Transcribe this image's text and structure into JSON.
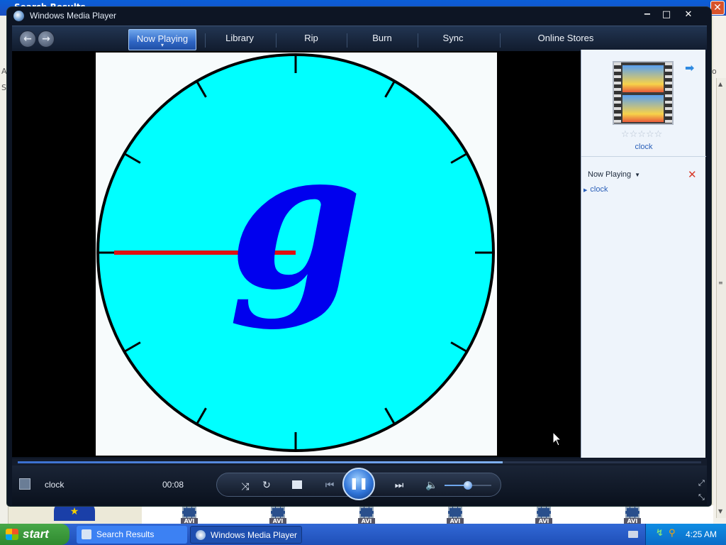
{
  "background": {
    "window_title": "Search Results",
    "left_gutter_letters": [
      "A",
      "S"
    ],
    "right_gutter_letter": "o",
    "file_thumb_label": "AVI"
  },
  "wmp": {
    "title": "Windows Media Player",
    "controls": {
      "minimize": "−",
      "maximize": "□",
      "close": "✕"
    },
    "nav": {
      "back_icon": "back-arrow-icon",
      "forward_icon": "forward-arrow-icon",
      "tabs": [
        {
          "label": "Now Playing",
          "active": true
        },
        {
          "label": "Library",
          "active": false
        },
        {
          "label": "Rip",
          "active": false
        },
        {
          "label": "Burn",
          "active": false
        },
        {
          "label": "Sync",
          "active": false
        },
        {
          "label": "Online Stores",
          "active": false
        }
      ]
    },
    "video": {
      "content": "analog clock face",
      "face_color": "#00ffff",
      "hand_color": "#e01010",
      "logo_color": "#0000ee",
      "logo_glyph": "g"
    },
    "panel": {
      "album_caption": "clock",
      "rating": "☆☆☆☆☆",
      "playlist_title": "Now Playing",
      "playlist_items": [
        "clock"
      ],
      "accent": "#2a5fb8"
    },
    "seek": {
      "progress": 0.71
    },
    "transport": {
      "media_title": "clock",
      "elapsed": "00:08",
      "volume": 0.5,
      "state": "playing"
    }
  },
  "taskbar": {
    "start_label": "start",
    "buttons": [
      {
        "label": "Search Results",
        "active": false
      },
      {
        "label": "Windows Media Player",
        "active": true
      }
    ],
    "clock": "4:25 AM"
  }
}
